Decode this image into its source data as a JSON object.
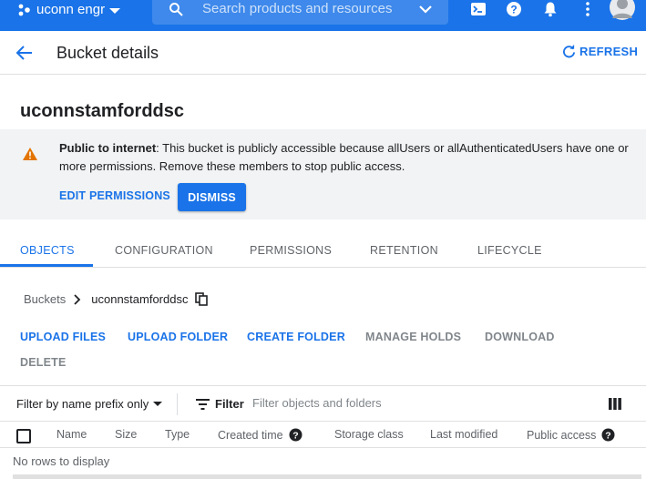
{
  "topbar": {
    "project_name": "uconn engr",
    "search_placeholder": "Search products and resources",
    "icons": [
      "cloud-shell-icon",
      "help-icon",
      "notifications-icon",
      "more-vert-icon",
      "account-avatar-icon"
    ],
    "color": "#1a73e8"
  },
  "header": {
    "title": "Bucket details",
    "refresh_label": "REFRESH"
  },
  "bucket": {
    "name": "uconnstamforddsc"
  },
  "banner": {
    "bold": "Public to internet",
    "message": ": This bucket is publicly accessible because allUsers or allAuthenticatedUsers have one or more permissions. Remove these members to stop public access.",
    "edit_label": "EDIT PERMISSIONS",
    "dismiss_label": "DISMISS",
    "warning_color": "#e37400"
  },
  "tabs": [
    {
      "label": "OBJECTS",
      "active": true
    },
    {
      "label": "CONFIGURATION",
      "active": false
    },
    {
      "label": "PERMISSIONS",
      "active": false
    },
    {
      "label": "RETENTION",
      "active": false
    },
    {
      "label": "LIFECYCLE",
      "active": false
    }
  ],
  "breadcrumb": {
    "root": "Buckets",
    "current": "uconnstamforddsc"
  },
  "actions": {
    "upload_files": "UPLOAD FILES",
    "upload_folder": "UPLOAD FOLDER",
    "create_folder": "CREATE FOLDER",
    "manage_holds": "MANAGE HOLDS",
    "download": "DOWNLOAD",
    "delete": "DELETE"
  },
  "filter": {
    "mode": "Filter by name prefix only",
    "label": "Filter",
    "placeholder": "Filter objects and folders"
  },
  "table": {
    "columns": [
      "Name",
      "Size",
      "Type",
      "Created time",
      "Storage class",
      "Last modified",
      "Public access"
    ],
    "empty": "No rows to display"
  }
}
